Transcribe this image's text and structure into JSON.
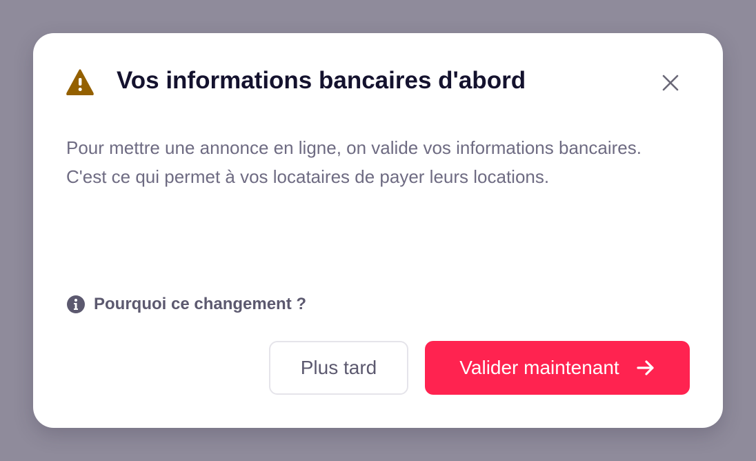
{
  "dialog": {
    "title": "Vos informations bancaires d'abord",
    "body": "Pour mettre une annonce en ligne, on valide vos informations bancaires. C'est ce qui permet à vos locataires de payer leurs locations.",
    "why_link": "Pourquoi ce changement ?",
    "secondary_button": "Plus tard",
    "primary_button": "Valider maintenant",
    "icons": {
      "title": "warning-icon",
      "close": "close-icon",
      "why_link": "info-icon",
      "primary_button": "arrow-right-icon"
    }
  },
  "colors": {
    "backdrop": "#8f8b9b",
    "dialog_background": "#ffffff",
    "title_text": "#14122e",
    "body_text": "#6e6b82",
    "warning": "#946000",
    "primary_button": "#ff2350",
    "secondary_button_border": "#e5e4ea"
  }
}
